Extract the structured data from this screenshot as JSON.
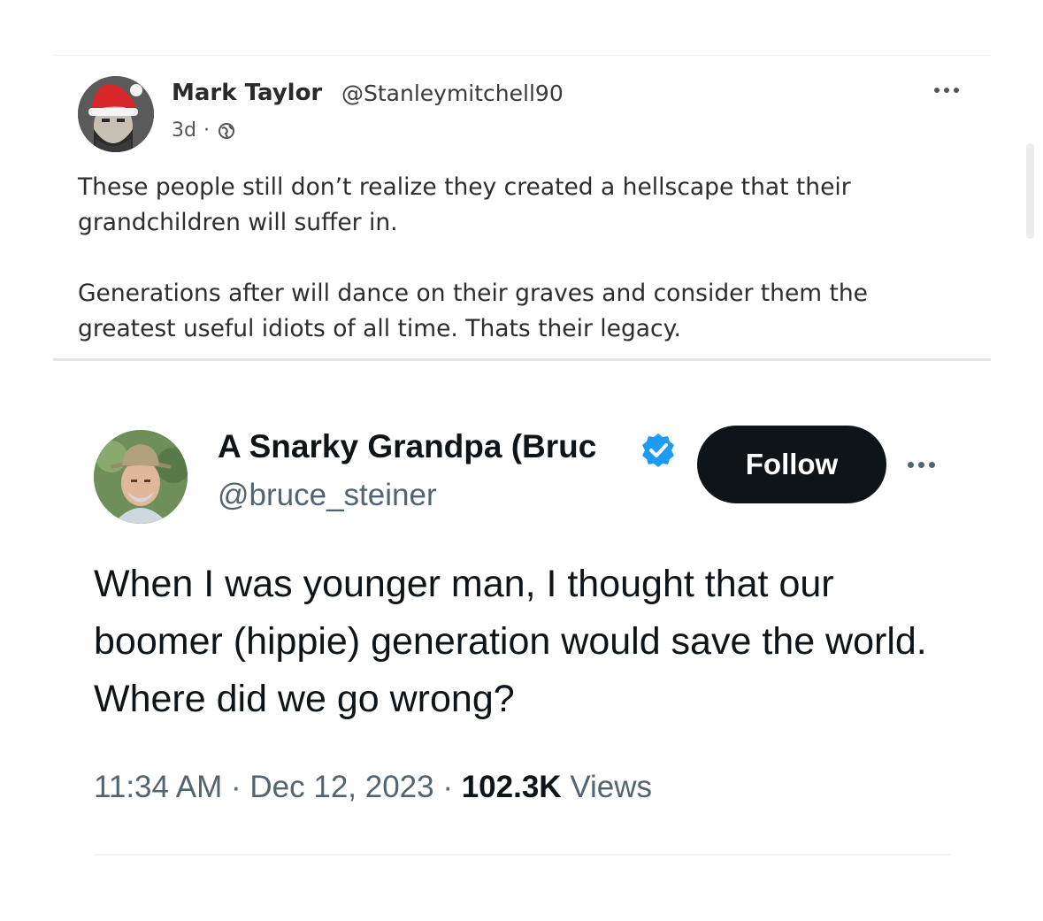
{
  "post": {
    "author_name": "Mark Taylor",
    "author_handle": "@Stanleymitchell90",
    "time": "3d",
    "separator": "·",
    "audience_icon": "globe-icon",
    "more_icon": "more-horizontal-icon",
    "paragraphs": [
      "These people still don’t realize they created a hellscape that their grandchildren will suffer in.",
      "Generations after will dance on their graves and consider them the greatest useful idiots of all time. Thats their legacy."
    ]
  },
  "tweet": {
    "author_name": "A Snarky Grandpa (Bruc",
    "verified_icon": "verified-badge-icon",
    "author_handle": "@bruce_steiner",
    "follow_label": "Follow",
    "more_icon": "more-horizontal-icon",
    "text": "When I was younger man, I thought that our boomer (hippie) generation would save the world. Where did we go wrong?",
    "time": "11:34 AM",
    "sep1": " · ",
    "date": "Dec 12, 2023",
    "sep2": " · ",
    "views_count": "102.3K",
    "views_label": " Views"
  },
  "colors": {
    "follow_button_bg": "#0f1419",
    "verified_badge": "#1d9bf0",
    "secondary_text": "#536471"
  }
}
